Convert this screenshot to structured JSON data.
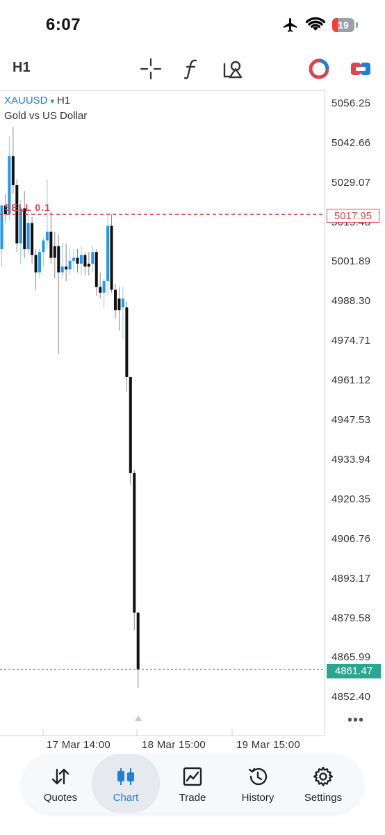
{
  "status_bar": {
    "time": "6:07",
    "battery": "19",
    "icons": [
      "airplane-icon",
      "wifi-icon",
      "battery-icon"
    ]
  },
  "toolbar": {
    "timeframe": "H1",
    "icons": [
      "crosshair-icon",
      "indicators-icon",
      "objects-icon",
      "one-click-trading-icon",
      "trade-toggle-icon"
    ]
  },
  "chart": {
    "symbol": "XAUUSD",
    "symbol_arrow": "▾",
    "timeframe": "H1",
    "description": "Gold vs US Dollar",
    "sell_order_label": "SELL 0.1",
    "sell_order_price": "5017.95",
    "current_price": "4861.47",
    "more": "•••",
    "price_axis": [
      "5056.25",
      "5042.66",
      "5029.07",
      "5015.48",
      "5001.89",
      "4988.30",
      "4974.71",
      "4961.12",
      "4947.53",
      "4933.94",
      "4920.35",
      "4906.76",
      "4893.17",
      "4879.58",
      "4865.99",
      "4852.40"
    ],
    "time_axis": [
      "17 Mar 14:00",
      "18 Mar 15:00",
      "19 Mar 15:00"
    ]
  },
  "chart_data": {
    "type": "candlestick",
    "title": "",
    "ylim": [
      4843,
      5065
    ],
    "price_lines": {
      "sell_order": 5017.95,
      "current": 4861.47
    },
    "candles": [
      {
        "o": 5006,
        "h": 5021,
        "l": 5000,
        "c": 5021,
        "color": "blue"
      },
      {
        "o": 5021,
        "h": 5025,
        "l": 5015,
        "c": 5018,
        "color": "black"
      },
      {
        "o": 5018,
        "h": 5045,
        "l": 5016,
        "c": 5038,
        "color": "blue"
      },
      {
        "o": 5038,
        "h": 5048,
        "l": 5025,
        "c": 5028,
        "color": "black"
      },
      {
        "o": 5028,
        "h": 5030,
        "l": 5005,
        "c": 5008,
        "color": "black"
      },
      {
        "o": 5008,
        "h": 5023,
        "l": 5001,
        "c": 5020,
        "color": "blue"
      },
      {
        "o": 5020,
        "h": 5026,
        "l": 5003,
        "c": 5006,
        "color": "black"
      },
      {
        "o": 5006,
        "h": 5020,
        "l": 5004,
        "c": 5015,
        "color": "blue"
      },
      {
        "o": 5015,
        "h": 5017,
        "l": 5001,
        "c": 5004,
        "color": "black"
      },
      {
        "o": 5004,
        "h": 5006,
        "l": 4992,
        "c": 4998,
        "color": "black"
      },
      {
        "o": 4998,
        "h": 5006,
        "l": 4996,
        "c": 5005,
        "color": "blue"
      },
      {
        "o": 5005,
        "h": 5010,
        "l": 5000,
        "c": 5009,
        "color": "blue"
      },
      {
        "o": 5009,
        "h": 5030,
        "l": 5006,
        "c": 5012,
        "color": "blue"
      },
      {
        "o": 5012,
        "h": 5019,
        "l": 5001,
        "c": 5003,
        "color": "black"
      },
      {
        "o": 5003,
        "h": 5012,
        "l": 4996,
        "c": 5007,
        "color": "black"
      },
      {
        "o": 5007,
        "h": 5011,
        "l": 4970,
        "c": 4998,
        "color": "black"
      },
      {
        "o": 4998,
        "h": 5008,
        "l": 4996,
        "c": 5000,
        "color": "blue"
      },
      {
        "o": 5000,
        "h": 5008,
        "l": 4995,
        "c": 4999,
        "color": "black"
      },
      {
        "o": 4999,
        "h": 5006,
        "l": 4997,
        "c": 5002,
        "color": "blue"
      },
      {
        "o": 5002,
        "h": 5006,
        "l": 4998,
        "c": 5003,
        "color": "blue"
      },
      {
        "o": 5003,
        "h": 5006,
        "l": 4998,
        "c": 5001,
        "color": "black"
      },
      {
        "o": 5001,
        "h": 5007,
        "l": 4997,
        "c": 5004,
        "color": "blue"
      },
      {
        "o": 5004,
        "h": 5005,
        "l": 4997,
        "c": 5000,
        "color": "black"
      },
      {
        "o": 5000,
        "h": 5005,
        "l": 4997,
        "c": 5001,
        "color": "black"
      },
      {
        "o": 5001,
        "h": 5007,
        "l": 4998,
        "c": 5005,
        "color": "blue"
      },
      {
        "o": 5005,
        "h": 5006,
        "l": 4990,
        "c": 4993,
        "color": "black"
      },
      {
        "o": 4993,
        "h": 4998,
        "l": 4989,
        "c": 4991,
        "color": "black"
      },
      {
        "o": 4991,
        "h": 4996,
        "l": 4986,
        "c": 4995,
        "color": "blue"
      },
      {
        "o": 4995,
        "h": 5018,
        "l": 4990,
        "c": 5014,
        "color": "blue"
      },
      {
        "o": 5014,
        "h": 5018,
        "l": 4991,
        "c": 4992,
        "color": "black"
      },
      {
        "o": 4992,
        "h": 4994,
        "l": 4982,
        "c": 4985,
        "color": "black"
      },
      {
        "o": 4985,
        "h": 4993,
        "l": 4978,
        "c": 4989,
        "color": "black"
      },
      {
        "o": 4989,
        "h": 4993,
        "l": 4975,
        "c": 4986,
        "color": "blue"
      },
      {
        "o": 4986,
        "h": 4988,
        "l": 4957,
        "c": 4962,
        "color": "black"
      },
      {
        "o": 4962,
        "h": 4962,
        "l": 4925,
        "c": 4929,
        "color": "black"
      },
      {
        "o": 4929,
        "h": 4930,
        "l": 4875,
        "c": 4881,
        "color": "black"
      },
      {
        "o": 4881,
        "h": 4881,
        "l": 4855,
        "c": 4861.47,
        "color": "black"
      }
    ]
  },
  "tabbar": {
    "tabs": [
      {
        "label": "Quotes",
        "icon": "quotes-arrows-icon"
      },
      {
        "label": "Chart",
        "icon": "candlestick-chart-icon"
      },
      {
        "label": "Trade",
        "icon": "trade-chart-icon"
      },
      {
        "label": "History",
        "icon": "history-clock-icon"
      },
      {
        "label": "Settings",
        "icon": "gear-icon"
      }
    ],
    "active": "Chart",
    "accent_color": "#1d7fd6"
  },
  "colors": {
    "bull_candle": "#2196f3",
    "bear_candle": "#111111",
    "sell_line": "#e0434b",
    "current_line": "#2aa58f"
  }
}
